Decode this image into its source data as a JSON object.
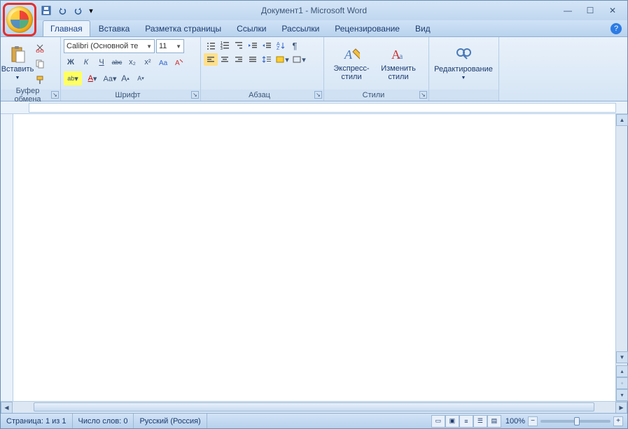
{
  "title": "Документ1 - Microsoft Word",
  "qat": {
    "save": "save-icon",
    "undo": "undo-icon",
    "redo": "redo-icon"
  },
  "tabs": [
    "Главная",
    "Вставка",
    "Разметка страницы",
    "Ссылки",
    "Рассылки",
    "Рецензирование",
    "Вид"
  ],
  "active_tab": 0,
  "ribbon": {
    "clipboard": {
      "title": "Буфер обмена",
      "paste": "Вставить"
    },
    "font": {
      "title": "Шрифт",
      "name": "Calibri (Основной те",
      "size": "11",
      "bold": "Ж",
      "italic": "К",
      "underline": "Ч",
      "strike": "abc",
      "sub": "x₂",
      "sup": "x²",
      "case": "Aa",
      "clear": "A",
      "highlight": "ab",
      "fontcolor": "A",
      "grow": "A",
      "shrink": "A"
    },
    "para": {
      "title": "Абзац"
    },
    "styles": {
      "title": "Стили",
      "quick": "Экспресс-стили",
      "change": "Изменить стили"
    },
    "editing": {
      "title": "",
      "find": "Редактирование"
    }
  },
  "status": {
    "page": "Страница: 1 из 1",
    "words": "Число слов: 0",
    "lang": "Русский (Россия)",
    "zoom": "100%"
  }
}
